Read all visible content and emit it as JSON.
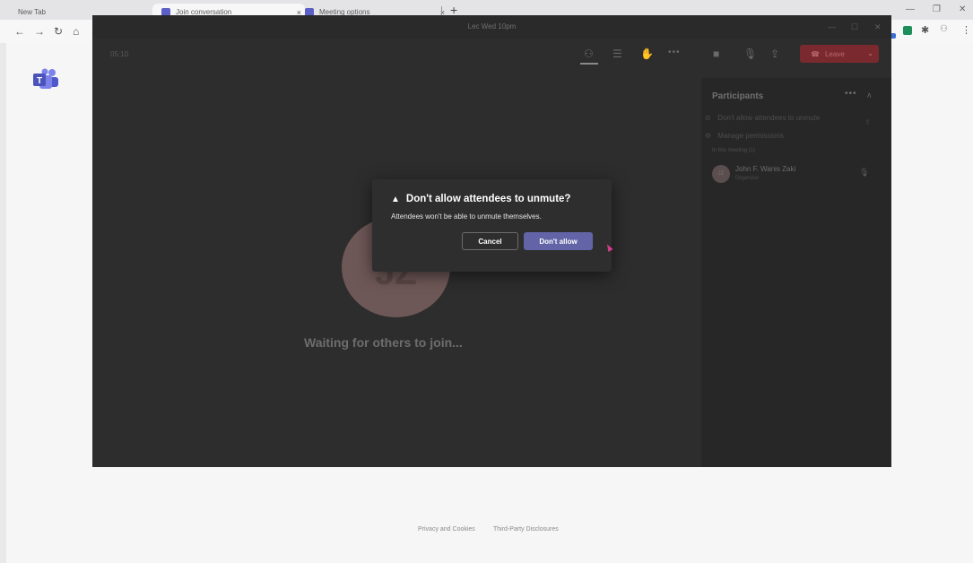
{
  "browser": {
    "tabs": [
      {
        "label": "New Tab"
      },
      {
        "label": "Join conversation"
      },
      {
        "label": "Meeting options"
      }
    ],
    "new_tab_symbol": "+",
    "close_symbol": "×"
  },
  "meeting": {
    "title": "Lec Wed 10pm",
    "timer": "05:10",
    "leave_label": "Leave",
    "stage_initials": "JZ",
    "waiting_text": "Waiting for others to join..."
  },
  "participants": {
    "title": "Participants",
    "actions": [
      {
        "label": "Don't allow attendees to unmute"
      },
      {
        "label": "Manage permissions"
      }
    ],
    "section_label": "In this meeting (1)",
    "people": [
      {
        "initials": "JZ",
        "name": "John F. Wanis Zaki",
        "role": "Organizer"
      }
    ]
  },
  "dialog": {
    "title": "Don't allow attendees to unmute?",
    "body": "Attendees won't be able to unmute themselves.",
    "cancel_label": "Cancel",
    "confirm_label": "Don't allow"
  },
  "footer": {
    "links": [
      {
        "label": "Privacy and Cookies"
      },
      {
        "label": "Third-Party Disclosures"
      }
    ]
  },
  "colors": {
    "accent": "#6264a7",
    "leave": "#7a2a2e",
    "meeting_bg": "#2d2d2d"
  }
}
